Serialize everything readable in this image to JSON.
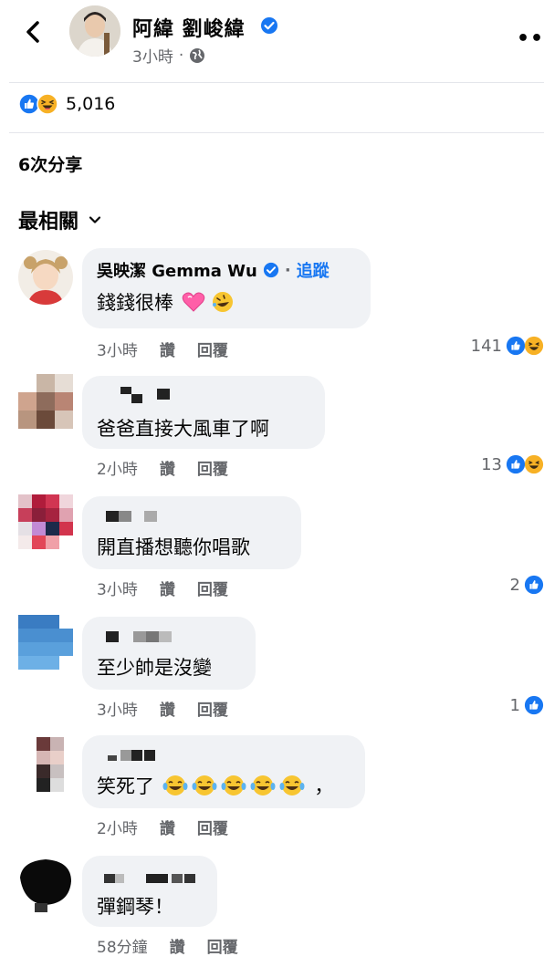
{
  "header": {
    "author_name": "阿緯 劉峻緯",
    "time": "3小時",
    "dot": "·",
    "more_label": "•••"
  },
  "reactions": {
    "count": "5,016"
  },
  "shares": {
    "label": "6次分享"
  },
  "sort": {
    "label": "最相關"
  },
  "comments": [
    {
      "name": "吳映潔 Gemma Wu",
      "follow": "追蹤",
      "text": "錢錢很棒",
      "time": "3小時",
      "like": "讚",
      "reply": "回覆",
      "react_count": "141"
    },
    {
      "name": "",
      "text": "爸爸直接大風車了啊",
      "time": "2小時",
      "like": "讚",
      "reply": "回覆",
      "react_count": "13"
    },
    {
      "name": "",
      "text": "開直播想聽你唱歌",
      "time": "3小時",
      "like": "讚",
      "reply": "回覆",
      "react_count": "2"
    },
    {
      "name": "",
      "text": "至少帥是沒變",
      "time": "3小時",
      "like": "讚",
      "reply": "回覆",
      "react_count": "1"
    },
    {
      "name": "",
      "text": "笑死了",
      "text_suffix": "，",
      "time": "2小時",
      "like": "讚",
      "reply": "回覆"
    },
    {
      "name": "",
      "text": "彈鋼琴！",
      "time": "58分鐘",
      "like": "讚",
      "reply": "回覆"
    }
  ],
  "colors": {
    "accent": "#1877f2",
    "muted": "#65676b",
    "bubble": "#f0f2f5"
  }
}
